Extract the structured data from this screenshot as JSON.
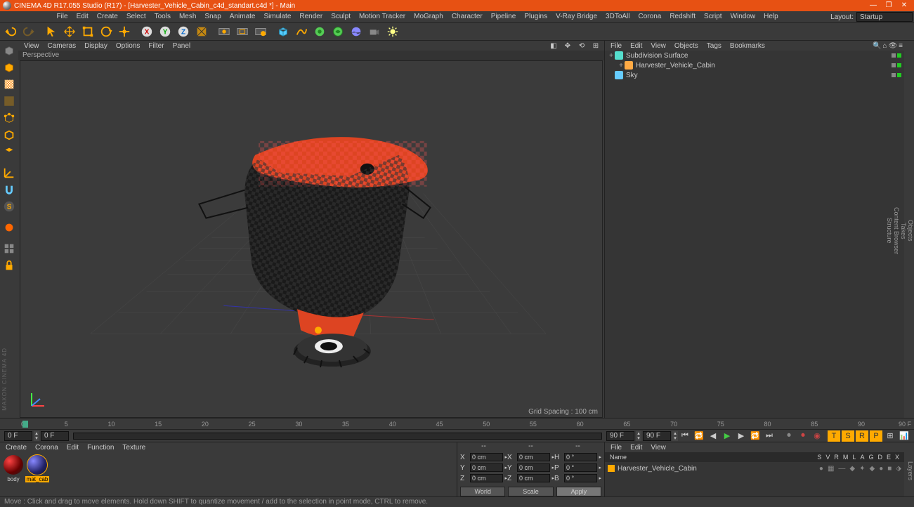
{
  "title": "CINEMA 4D R17.055 Studio (R17) - [Harvester_Vehicle_Cabin_c4d_standart.c4d *] - Main",
  "menu": [
    "File",
    "Edit",
    "Create",
    "Select",
    "Tools",
    "Mesh",
    "Snap",
    "Animate",
    "Simulate",
    "Render",
    "Sculpt",
    "Motion Tracker",
    "MoGraph",
    "Character",
    "Pipeline",
    "Plugins",
    "V-Ray Bridge",
    "3DToAll",
    "Corona",
    "Redshift",
    "Script",
    "Window",
    "Help"
  ],
  "layout_label": "Layout:",
  "layout_value": "Startup",
  "viewmenu": [
    "View",
    "Cameras",
    "Display",
    "Options",
    "Filter",
    "Panel"
  ],
  "view_label": "Perspective",
  "grid_spacing": "Grid Spacing : 100 cm",
  "obj_menu": [
    "File",
    "Edit",
    "View",
    "Objects",
    "Tags",
    "Bookmarks"
  ],
  "objects": [
    {
      "name": "Subdivision Surface",
      "indent": 0,
      "icon": "subdiv",
      "color": "#5dc",
      "exp": "+"
    },
    {
      "name": "Harvester_Vehicle_Cabin",
      "indent": 1,
      "icon": "null",
      "color": "#fa4",
      "exp": "+"
    },
    {
      "name": "Sky",
      "indent": 0,
      "icon": "sky",
      "color": "#6cf",
      "exp": ""
    }
  ],
  "sidetabs": [
    "Objects",
    "Takes",
    "Content Browser",
    "Structure"
  ],
  "timeline": {
    "ticks": [
      "0",
      "5",
      "10",
      "15",
      "20",
      "25",
      "30",
      "35",
      "40",
      "45",
      "50",
      "55",
      "60",
      "65",
      "70",
      "75",
      "80",
      "85",
      "90"
    ],
    "endf": "90 F"
  },
  "playback": {
    "start": "0 F",
    "slider_start": "0 F",
    "slider_end": "90 F",
    "end": "90 F"
  },
  "mat_menu": [
    "Create",
    "Corona",
    "Edit",
    "Function",
    "Texture"
  ],
  "materials": [
    {
      "name": "body",
      "grad": "radial-gradient(circle at 30% 30%,#f44,#600 60%,#222)"
    },
    {
      "name": "mat_cab",
      "grad": "radial-gradient(circle at 30% 30%,#88f,#226 60%,#112)",
      "sel": true
    }
  ],
  "coord": {
    "hdr": [
      "--",
      "--",
      "--"
    ],
    "rows": [
      {
        "a": "X",
        "v1": "0 cm",
        "b": "X",
        "v2": "0 cm",
        "c": "H",
        "v3": "0 °"
      },
      {
        "a": "Y",
        "v1": "0 cm",
        "b": "Y",
        "v2": "0 cm",
        "c": "P",
        "v3": "0 °"
      },
      {
        "a": "Z",
        "v1": "0 cm",
        "b": "Z",
        "v2": "0 cm",
        "c": "B",
        "v3": "0 °"
      }
    ],
    "drops": [
      "World",
      "Scale"
    ],
    "apply": "Apply"
  },
  "attr_menu": [
    "File",
    "Edit",
    "View"
  ],
  "attr_cols": [
    "Name",
    "S",
    "V",
    "R",
    "M",
    "L",
    "A",
    "G",
    "D",
    "E",
    "X"
  ],
  "attr_item": "Harvester_Vehicle_Cabin",
  "statusbar": "Move : Click and drag to move elements. Hold down SHIFT to quantize movement / add to the selection in point mode, CTRL to remove.",
  "sidelogo": "MAXON CINEMA 4D",
  "rightsidetab": "Layers"
}
